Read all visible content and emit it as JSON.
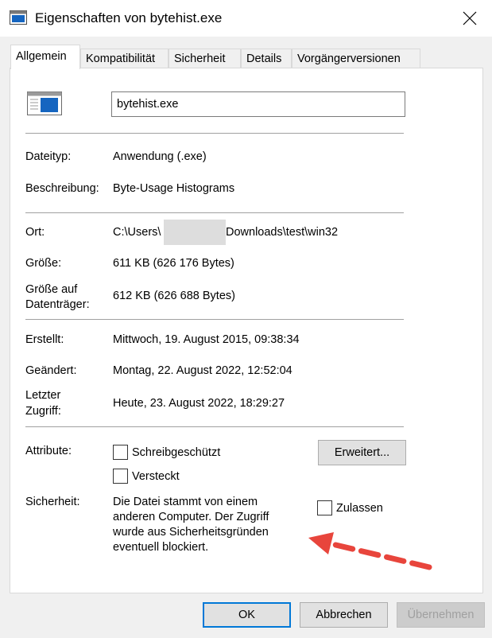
{
  "window": {
    "title": "Eigenschaften von bytehist.exe"
  },
  "tabs": [
    {
      "label": "Allgemein",
      "active": true
    },
    {
      "label": "Kompatibilität"
    },
    {
      "label": "Sicherheit"
    },
    {
      "label": "Details"
    },
    {
      "label": "Vorgängerversionen"
    }
  ],
  "general": {
    "file_name": "bytehist.exe",
    "type_label": "Dateityp:",
    "type_value": "Anwendung (.exe)",
    "description_label": "Beschreibung:",
    "description_value": "Byte-Usage Histograms",
    "location_label": "Ort:",
    "location_prefix": "C:\\Users\\",
    "location_suffix": "Downloads\\test\\win32",
    "size_label": "Größe:",
    "size_value": "611 KB (626 176 Bytes)",
    "disk_size_label_1": "Größe auf",
    "disk_size_label_2": "Datenträger:",
    "disk_size_value": "612 KB (626 688 Bytes)",
    "created_label": "Erstellt:",
    "created_value": "Mittwoch, 19. August 2015, 09:38:34",
    "modified_label": "Geändert:",
    "modified_value": "Montag, 22. August 2022, 12:52:04",
    "accessed_label_1": "Letzter",
    "accessed_label_2": "Zugriff:",
    "accessed_value": "Heute, 23. August 2022, 18:29:27",
    "attributes_label": "Attribute:",
    "readonly_label": "Schreibgeschützt",
    "hidden_label": "Versteckt",
    "advanced_button": "Erweitert...",
    "security_label": "Sicherheit:",
    "security_text_1": "Die Datei stammt von einem",
    "security_text_2": "anderen Computer. Der Zugriff",
    "security_text_3": "wurde aus Sicherheitsgründen",
    "security_text_4": "eventuell blockiert.",
    "unblock_label": "Zulassen"
  },
  "buttons": {
    "ok": "OK",
    "cancel": "Abbrechen",
    "apply": "Übernehmen"
  },
  "colors": {
    "accent": "#0078d7",
    "annotation_arrow": "#e8453c"
  },
  "icons": {
    "app": "application-window-icon",
    "close": "close-icon",
    "file": "executable-file-icon",
    "annotation": "red-dashed-arrow"
  }
}
